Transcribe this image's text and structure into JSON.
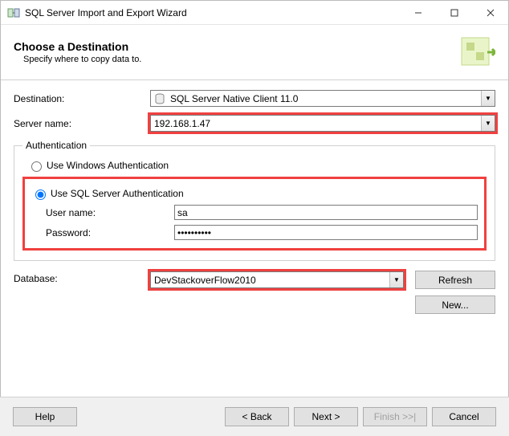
{
  "window": {
    "title": "SQL Server Import and Export Wizard"
  },
  "header": {
    "title": "Choose a Destination",
    "subtitle": "Specify where to copy data to."
  },
  "fields": {
    "destination_label": "Destination:",
    "destination_value": "SQL Server Native Client 11.0",
    "server_label": "Server name:",
    "server_value": "192.168.1.47"
  },
  "auth": {
    "legend": "Authentication",
    "windows_label": "Use Windows Authentication",
    "sql_label": "Use SQL Server Authentication",
    "selected": "sql",
    "username_label": "User name:",
    "username_value": "sa",
    "password_label": "Password:",
    "password_value": "••••••••••"
  },
  "database": {
    "label": "Database:",
    "value": "DevStackoverFlow2010",
    "refresh": "Refresh",
    "new": "New..."
  },
  "footer": {
    "help": "Help",
    "back": "< Back",
    "next": "Next >",
    "finish": "Finish >>|",
    "cancel": "Cancel"
  }
}
